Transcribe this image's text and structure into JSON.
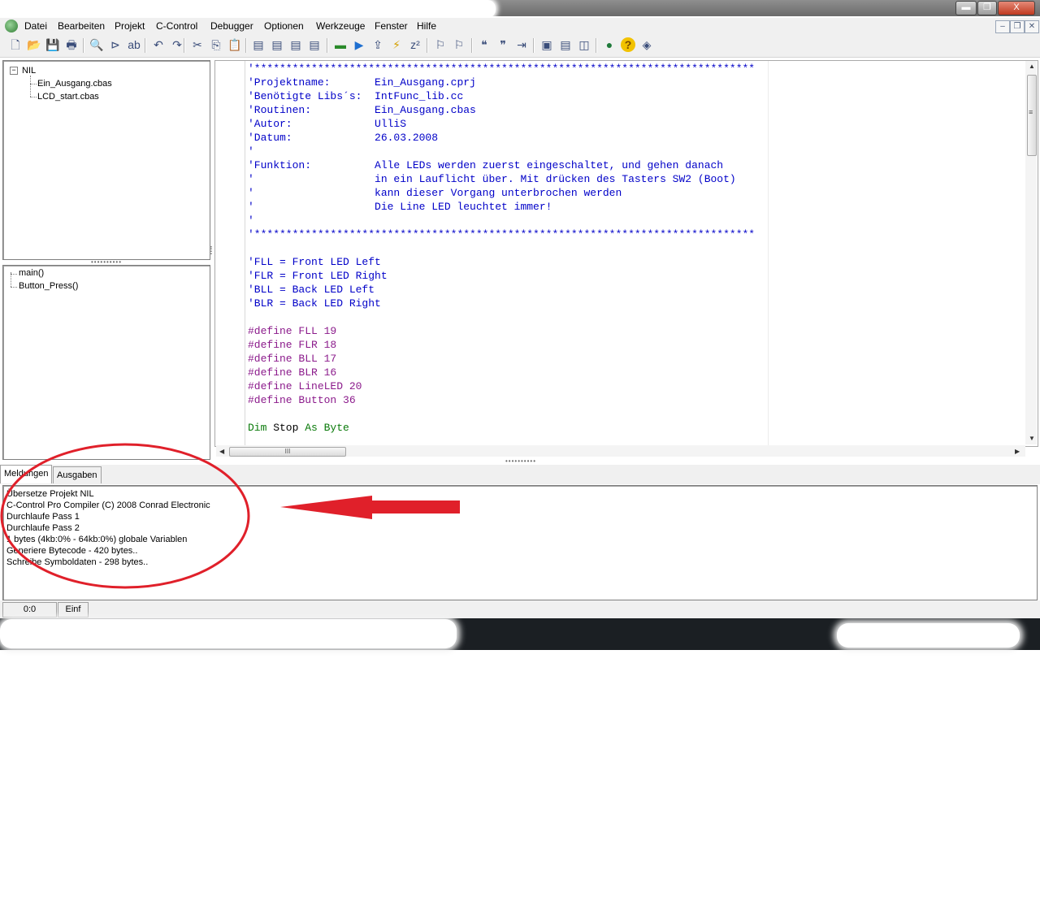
{
  "menu": {
    "items": [
      "Datei",
      "Bearbeiten",
      "Projekt",
      "C-Control",
      "Debugger",
      "Optionen",
      "Werkzeuge",
      "Fenster",
      "Hilfe"
    ],
    "mdi_controls": [
      "–",
      "❐",
      "✕"
    ]
  },
  "window_controls": {
    "minimize": "▬",
    "maximize": "❐",
    "close": "X"
  },
  "toolbar": {
    "icons": [
      "new-file-icon",
      "open-folder-icon",
      "save-icon",
      "print-icon",
      "find-icon",
      "find-next-icon",
      "replace-icon",
      "undo-icon",
      "redo-icon",
      "cut-icon",
      "copy-icon",
      "paste-icon",
      "project-open-icon",
      "project-close-icon",
      "project-add-icon",
      "project-options-icon",
      "compile-icon",
      "run-icon",
      "download-icon",
      "flash-icon",
      "sleep-icon",
      "breakpoint-icon",
      "step-icon",
      "comment-icon",
      "uncomment-icon",
      "indent-icon",
      "cascade-windows-icon",
      "tile-horizontal-icon",
      "tile-vertical-icon",
      "web-icon",
      "help-icon",
      "about-icon"
    ],
    "glyphs": [
      "🗋",
      "📂",
      "💾",
      "🖶",
      "🔍",
      "⊳",
      "ab",
      "↶",
      "↷",
      "✂",
      "⎘",
      "📋",
      "▤",
      "▤",
      "▤",
      "▤",
      "▬",
      "▶",
      "⇪",
      "⚡",
      "z²",
      "⚐",
      "⚐",
      "❝",
      "❞",
      "⇥",
      "▣",
      "▤",
      "◫",
      "●",
      "?",
      "◈"
    ]
  },
  "project_tree": {
    "root": "NIL",
    "expander": "−",
    "files": [
      "Ein_Ausgang.cbas",
      "LCD_start.cbas"
    ]
  },
  "function_tree": {
    "items": [
      "main()",
      "Button_Press()"
    ]
  },
  "splitter_grips": {
    "left": "••••••••••",
    "main": "••••••••••",
    "vertical": "⁞"
  },
  "editor": {
    "lines": [
      {
        "cls": "c-comment",
        "text": "'*******************************************************************************"
      },
      {
        "cls": "c-comment",
        "text": "'Projektname:       Ein_Ausgang.cprj"
      },
      {
        "cls": "c-comment",
        "text": "'Benötigte Libs´s:  IntFunc_lib.cc"
      },
      {
        "cls": "c-comment",
        "text": "'Routinen:          Ein_Ausgang.cbas"
      },
      {
        "cls": "c-comment",
        "text": "'Autor:             UlliS"
      },
      {
        "cls": "c-comment",
        "text": "'Datum:             26.03.2008"
      },
      {
        "cls": "c-comment",
        "text": "'"
      },
      {
        "cls": "c-comment",
        "text": "'Funktion:          Alle LEDs werden zuerst eingeschaltet, und gehen danach"
      },
      {
        "cls": "c-comment",
        "text": "'                   in ein Lauflicht über. Mit drücken des Tasters SW2 (Boot)"
      },
      {
        "cls": "c-comment",
        "text": "'                   kann dieser Vorgang unterbrochen werden"
      },
      {
        "cls": "c-comment",
        "text": "'                   Die Line LED leuchtet immer!"
      },
      {
        "cls": "c-comment",
        "text": "'"
      },
      {
        "cls": "c-comment",
        "text": "'*******************************************************************************"
      },
      {
        "cls": "c-plain",
        "text": ""
      },
      {
        "cls": "c-comment",
        "text": "'FLL = Front LED Left"
      },
      {
        "cls": "c-comment",
        "text": "'FLR = Front LED Right"
      },
      {
        "cls": "c-comment",
        "text": "'BLL = Back LED Left"
      },
      {
        "cls": "c-comment",
        "text": "'BLR = Back LED Right"
      },
      {
        "cls": "c-plain",
        "text": ""
      },
      {
        "cls": "c-pre",
        "text": "#define FLL 19"
      },
      {
        "cls": "c-pre",
        "text": "#define FLR 18"
      },
      {
        "cls": "c-pre",
        "text": "#define BLL 17"
      },
      {
        "cls": "c-pre",
        "text": "#define BLR 16"
      },
      {
        "cls": "c-pre",
        "text": "#define LineLED 20"
      },
      {
        "cls": "c-pre",
        "text": "#define Button 36"
      },
      {
        "cls": "c-plain",
        "text": ""
      }
    ],
    "last_line": {
      "kw1": "Dim",
      "name": " Stop ",
      "kw2": "As",
      "type": " Byte"
    }
  },
  "scrollbars": {
    "up": "▲",
    "down": "▼",
    "left": "◀",
    "right": "▶",
    "hthumb_grip": "III",
    "vthumb_grip": "≡"
  },
  "messages": {
    "tabs": [
      "Meldungen",
      "Ausgaben"
    ],
    "lines": [
      "Übersetze Projekt NIL",
      "C-Control Pro Compiler (C) 2008  Conrad Electronic",
      "Durchlaufe Pass 1",
      "Durchlaufe Pass 2",
      "1 bytes (4kb:0% - 64kb:0%) globale Variablen",
      "Generiere Bytecode - 420 bytes..",
      "Schreibe Symboldaten - 298 bytes.."
    ]
  },
  "statusbar": {
    "position": "0:0",
    "mode": "Einf"
  },
  "annotation": {
    "color": "#e0202a"
  }
}
